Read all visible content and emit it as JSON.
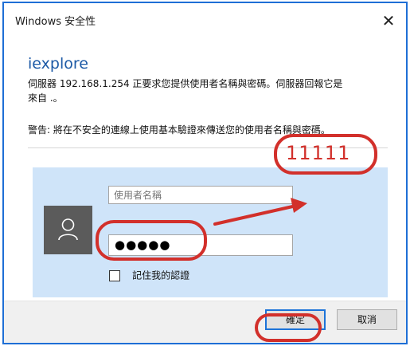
{
  "window": {
    "title": "Windows 安全性",
    "close_glyph": "✕"
  },
  "app": {
    "name": "iexplore"
  },
  "message": {
    "line1": "伺服器 192.168.1.254 正要求您提供使用者名稱與密碼。伺服器回報它是",
    "line2": "來自 .。"
  },
  "warning": {
    "text": "警告: 將在不安全的連線上使用基本驗證來傳送您的使用者名稱與密碼。"
  },
  "credentials": {
    "avatar_icon": "user-icon",
    "username_placeholder": "使用者名稱",
    "username_value": "",
    "password_mask": "●●●●●",
    "remember_label": "記住我的認證",
    "remember_checked": false
  },
  "buttons": {
    "ok_label": "確定",
    "cancel_label": "取消"
  },
  "annotation": {
    "text": "11111",
    "color": "#d2302b"
  },
  "colors": {
    "accent": "#1e6fd6",
    "panel_background": "#cfe4f9",
    "app_name": "#1d5aa6",
    "annotation": "#d2302b"
  }
}
